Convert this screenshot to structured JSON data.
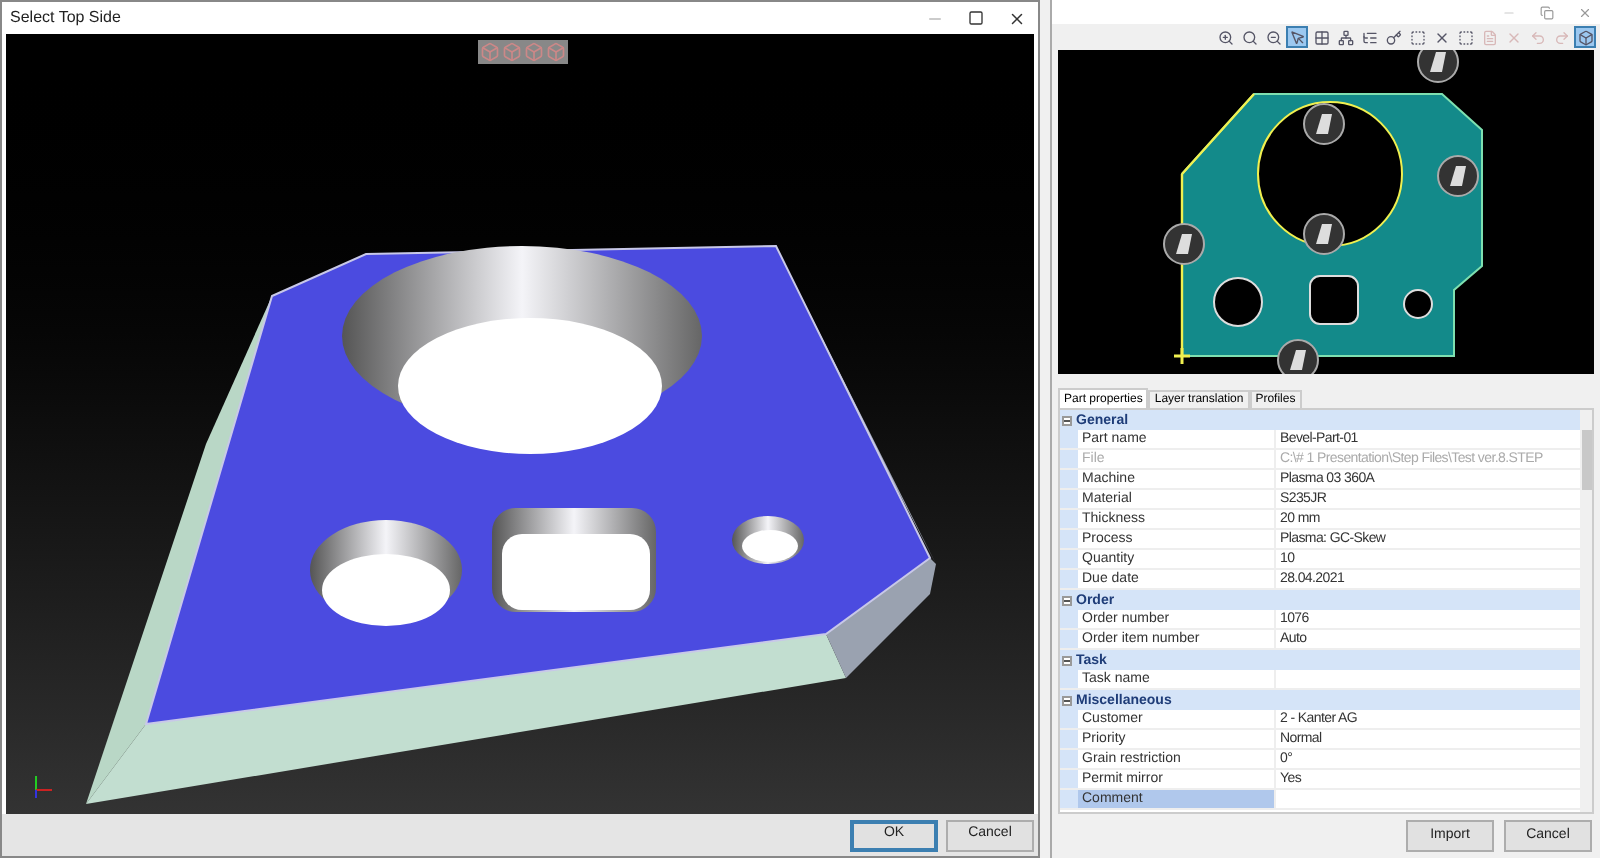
{
  "left_window": {
    "title": "Select Top Side",
    "buttons": [
      {
        "label": "OK",
        "kind": "default"
      },
      {
        "label": "Cancel",
        "kind": "normal"
      }
    ]
  },
  "right_window": {
    "toolbar": [
      {
        "kind": "zoom-in",
        "selected": false,
        "disabled": false
      },
      {
        "kind": "zoom",
        "selected": false,
        "disabled": false
      },
      {
        "kind": "zoom-out",
        "selected": false,
        "disabled": false
      },
      {
        "kind": "pointer",
        "selected": true,
        "disabled": false
      },
      {
        "kind": "grid",
        "selected": false,
        "disabled": false
      },
      {
        "kind": "tree",
        "selected": false,
        "disabled": false
      },
      {
        "kind": "list",
        "selected": false,
        "disabled": false
      },
      {
        "kind": "key",
        "selected": false,
        "disabled": false
      },
      {
        "kind": "marquee",
        "selected": false,
        "disabled": false
      },
      {
        "kind": "cross",
        "selected": false,
        "disabled": false
      },
      {
        "kind": "marquee",
        "selected": false,
        "disabled": false
      },
      {
        "kind": "page",
        "selected": false,
        "disabled": true
      },
      {
        "kind": "delete",
        "selected": false,
        "disabled": true
      },
      {
        "kind": "undo",
        "selected": false,
        "disabled": true
      },
      {
        "kind": "redo",
        "selected": false,
        "disabled": true
      },
      {
        "kind": "cube",
        "selected": true,
        "disabled": false
      }
    ],
    "tabs": [
      {
        "label": "Part properties",
        "selected": true
      },
      {
        "label": "Layer translation",
        "selected": false
      },
      {
        "label": "Profiles",
        "selected": false
      }
    ],
    "properties": [
      {
        "category": "General",
        "expanded": true,
        "rows": [
          {
            "name": "Part name",
            "value": "Bevel-Part-01",
            "disabled": false,
            "selected": false
          },
          {
            "name": "File",
            "value": "C:\\# 1 Presentation\\Step Files\\Test ver.8.STEP",
            "disabled": true,
            "selected": false
          },
          {
            "name": "Machine",
            "value": "Plasma 03 360A",
            "disabled": false,
            "selected": false
          },
          {
            "name": "Material",
            "value": "S235JR",
            "disabled": false,
            "selected": false
          },
          {
            "name": "Thickness",
            "value": "20 mm",
            "disabled": false,
            "selected": false
          },
          {
            "name": "Process",
            "value": "Plasma: GC-Skew",
            "disabled": false,
            "selected": false
          },
          {
            "name": "Quantity",
            "value": "10",
            "disabled": false,
            "selected": false
          },
          {
            "name": "Due date",
            "value": "28.04.2021",
            "disabled": false,
            "selected": false
          }
        ]
      },
      {
        "category": "Order",
        "expanded": true,
        "rows": [
          {
            "name": "Order number",
            "value": "1076",
            "disabled": false,
            "selected": false
          },
          {
            "name": "Order item number",
            "value": "Auto",
            "disabled": false,
            "selected": false
          }
        ]
      },
      {
        "category": "Task",
        "expanded": true,
        "rows": [
          {
            "name": "Task name",
            "disabled": false,
            "selected": false
          }
        ]
      },
      {
        "category": "Miscellaneous",
        "expanded": true,
        "rows": [
          {
            "name": "Customer",
            "value": "2 - Kanter AG",
            "disabled": false,
            "selected": false
          },
          {
            "name": "Priority",
            "value": "Normal",
            "disabled": false,
            "selected": false
          },
          {
            "name": "Grain restriction",
            "value": "0°",
            "disabled": false,
            "selected": false
          },
          {
            "name": "Permit mirror",
            "value": "Yes",
            "disabled": false,
            "selected": false
          },
          {
            "name": "Comment",
            "disabled": false,
            "selected": true
          }
        ]
      }
    ],
    "buttons": [
      {
        "label": "Import",
        "kind": "normal"
      },
      {
        "label": "Cancel",
        "kind": "normal"
      }
    ]
  }
}
